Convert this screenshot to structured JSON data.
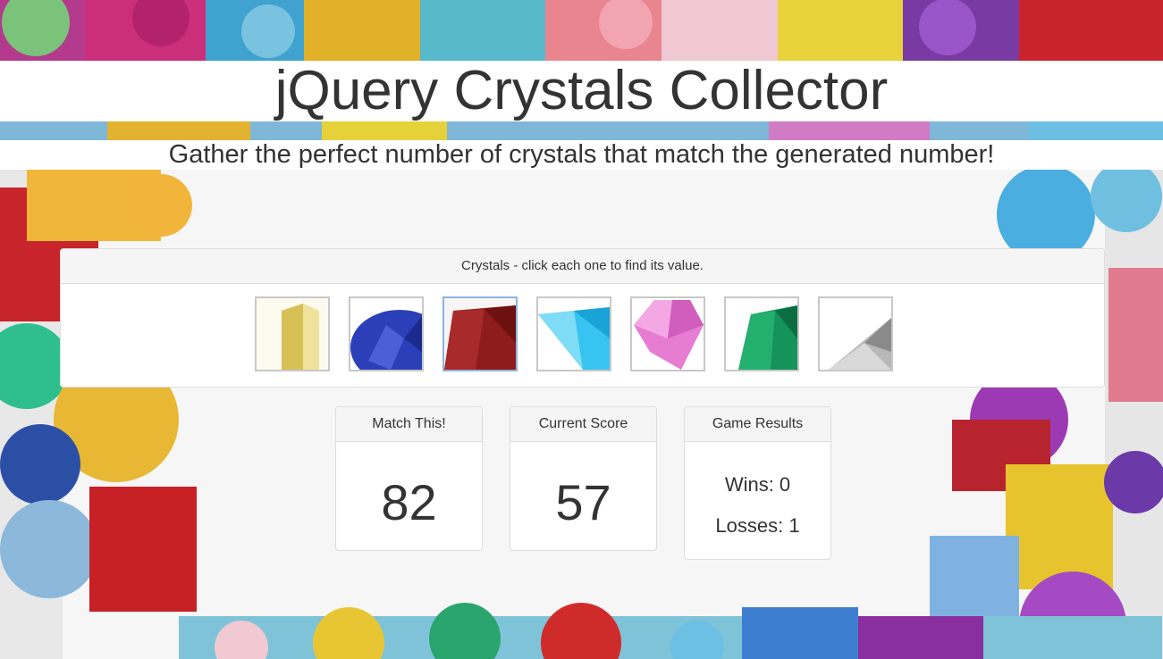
{
  "header": {
    "title": "jQuery Crystals Collector",
    "subtitle": "Gather the perfect number of crystals that match the generated number!"
  },
  "crystals": {
    "heading": "Crystals - click each one to find its value.",
    "items": [
      {
        "name": "yellow-crystal",
        "color": "#e6d36b"
      },
      {
        "name": "blue-crystal",
        "color": "#2b3fb8"
      },
      {
        "name": "red-crystal",
        "color": "#8e1c1c"
      },
      {
        "name": "cyan-crystal",
        "color": "#38c4f0"
      },
      {
        "name": "pink-crystal",
        "color": "#e77cd3"
      },
      {
        "name": "green-crystal",
        "color": "#15935a"
      },
      {
        "name": "clear-crystal",
        "color": "#b8b8b8"
      }
    ]
  },
  "target": {
    "label": "Match This!",
    "value": "82"
  },
  "score": {
    "label": "Current Score",
    "value": "57"
  },
  "results": {
    "label": "Game Results",
    "wins": "Wins: 0",
    "losses": "Losses: 1"
  }
}
